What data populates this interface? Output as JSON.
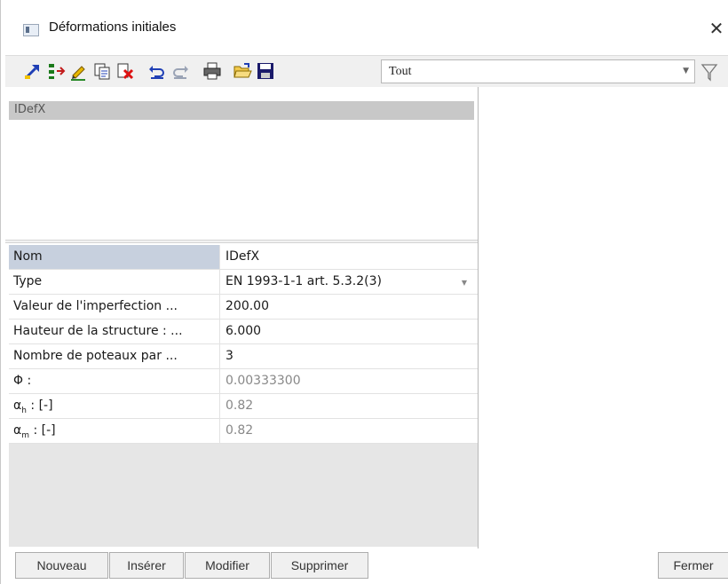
{
  "window": {
    "title": "Déformations initiales",
    "close_glyph": "✕"
  },
  "toolbar": {
    "buttons": [
      {
        "icon": "new-item-icon"
      },
      {
        "icon": "insert-icon"
      },
      {
        "icon": "edit-icon"
      },
      {
        "icon": "copy-icon"
      },
      {
        "icon": "delete-icon"
      },
      {
        "icon": "undo-icon"
      },
      {
        "icon": "redo-icon"
      },
      {
        "icon": "print-icon"
      },
      {
        "icon": "open-folder-icon"
      },
      {
        "icon": "save-icon"
      }
    ],
    "filter_value": "Tout",
    "filter_icon": "funnel-icon"
  },
  "list": {
    "items": [
      "IDefX"
    ]
  },
  "properties": {
    "rows": [
      {
        "name": "Nom",
        "value": "IDefX"
      },
      {
        "name": "Type",
        "value": "EN 1993-1-1 art. 5.3.2(3)"
      },
      {
        "name": "Valeur de l'imperfection ...",
        "value": "200.00"
      },
      {
        "name": "Hauteur de la structure : ...",
        "value": "6.000"
      },
      {
        "name": "Nombre de poteaux par ...",
        "value": "3"
      },
      {
        "name": "Φ :",
        "value": "0.00333300"
      },
      {
        "name_prefix": "α",
        "name_sub": "h",
        "name_suffix": " : [-]",
        "value": "0.82"
      },
      {
        "name_prefix": "α",
        "name_sub": "m",
        "name_suffix": " : [-]",
        "value": "0.82"
      }
    ]
  },
  "buttons": {
    "new": "Nouveau",
    "insert": "Insérer",
    "modify": "Modifier",
    "delete": "Supprimer",
    "close": "Fermer"
  },
  "colors": {
    "selected_row": "#c7d0de",
    "list_item_bg": "#c8c8c8",
    "readonly_text": "#888888"
  }
}
